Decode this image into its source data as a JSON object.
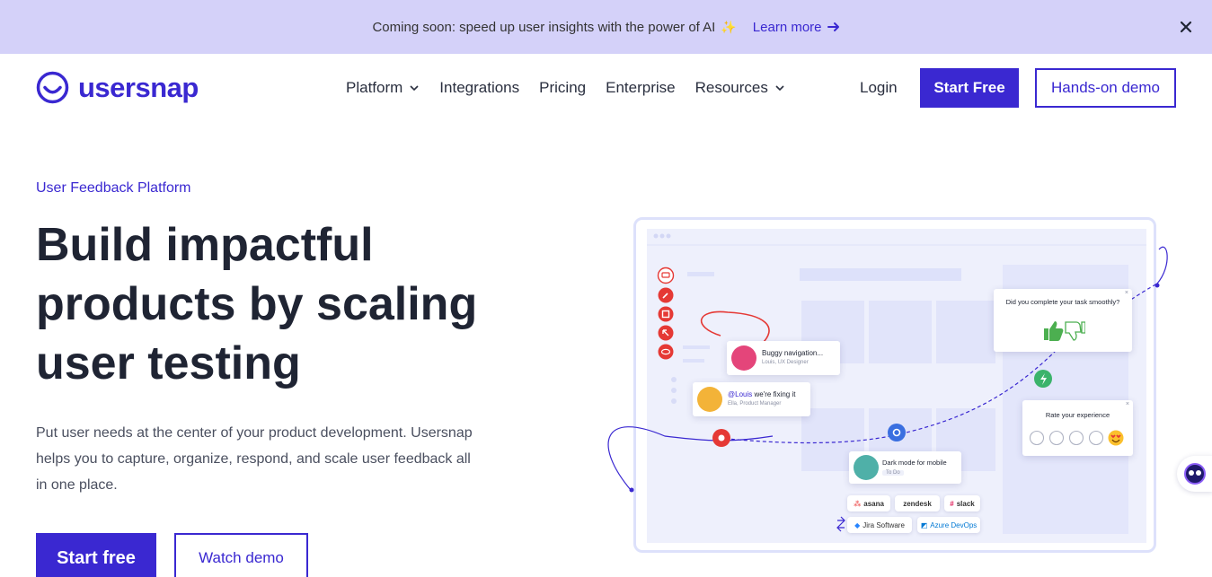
{
  "announcement": {
    "text": "Coming soon: speed up user insights with the power of AI",
    "sparkle": "✨",
    "link_label": "Learn more"
  },
  "header": {
    "logo_text": "usersnap",
    "nav": [
      {
        "label": "Platform",
        "has_dropdown": true
      },
      {
        "label": "Integrations",
        "has_dropdown": false
      },
      {
        "label": "Pricing",
        "has_dropdown": false
      },
      {
        "label": "Enterprise",
        "has_dropdown": false
      },
      {
        "label": "Resources",
        "has_dropdown": true
      }
    ],
    "login_label": "Login",
    "start_free_label": "Start Free",
    "demo_label": "Hands-on demo"
  },
  "hero": {
    "eyebrow": "User Feedback Platform",
    "headline": "Build impactful products by scaling user testing",
    "subtext": "Put user needs at the center of your product development. Usersnap helps you to capture, organize, respond, and scale user feedback all in one place.",
    "primary_cta": "Start free",
    "secondary_cta": "Watch demo"
  },
  "illustration": {
    "comment1_title": "Buggy navigation...",
    "comment1_sub": "Louis, UX Designer",
    "comment2_mention": "@Louis",
    "comment2_text": "we're fixing it",
    "comment2_sub": "Ella, Product Manager",
    "task_question": "Did you complete your task smoothly?",
    "rate_title": "Rate your experience",
    "ticket_title": "Dark mode for mobile",
    "ticket_status": "To Do",
    "integrations": [
      "asana",
      "zendesk",
      "slack",
      "Jira Software",
      "Azure DevOps"
    ]
  },
  "colors": {
    "brand": "#3a28d1",
    "announcement_bg": "#d4d1f9",
    "text_dark": "#1f2433"
  }
}
